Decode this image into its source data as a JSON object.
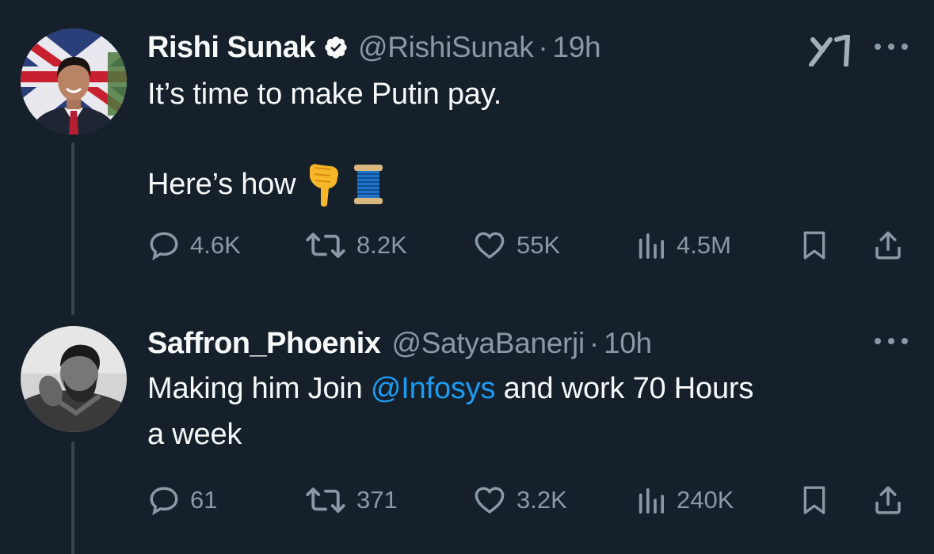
{
  "tweets": [
    {
      "display_name": "Rishi Sunak",
      "verified": true,
      "handle": "@RishiSunak",
      "separator": "·",
      "time": "19h",
      "lines": [
        "It’s time to make Putin pay.",
        "Here’s how"
      ],
      "emojis": [
        "backhand-index-pointing-down",
        "spool-of-thread"
      ],
      "stats": {
        "replies": "4.6K",
        "reposts": "8.2K",
        "likes": "55K",
        "views": "4.5M"
      }
    },
    {
      "display_name": "Saffron_Phoenix",
      "verified": false,
      "handle": "@SatyaBanerji",
      "separator": "·",
      "time": "10h",
      "text_before": "Making him Join ",
      "mention": "@Infosys",
      "text_after": " and work 70 Hours",
      "line2": "a week",
      "stats": {
        "replies": "61",
        "reposts": "371",
        "likes": "3.2K",
        "views": "240K"
      }
    }
  ],
  "icons": {
    "verified": "verified-badge-icon",
    "grok": "grok-icon",
    "more": "more-dots-icon",
    "reply": "reply-bubble-icon",
    "repost": "repost-arrows-icon",
    "like": "heart-icon",
    "views": "views-bars-icon",
    "bookmark": "bookmark-icon",
    "share": "share-upload-icon"
  },
  "colors": {
    "background": "#15202b",
    "text": "#f7f9f9",
    "muted": "#8b98a5",
    "accent": "#1d9bf0",
    "thread_line": "#38444d"
  }
}
